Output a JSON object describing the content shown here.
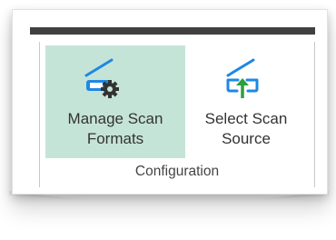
{
  "ribbon": {
    "group_label": "Configuration",
    "buttons": [
      {
        "line1": "Manage Scan",
        "line2": "Formats",
        "icon": "scanner-gear-icon",
        "selected": true,
        "highlight_color": "#c5e4d8"
      },
      {
        "line1": "Select Scan",
        "line2": "Source",
        "icon": "scanner-arrow-up-icon",
        "selected": false
      }
    ]
  },
  "colors": {
    "icon_blue": "#1e88e5",
    "icon_gear": "#333333",
    "icon_arrow": "#2e9e3e",
    "top_bar": "#404040"
  }
}
